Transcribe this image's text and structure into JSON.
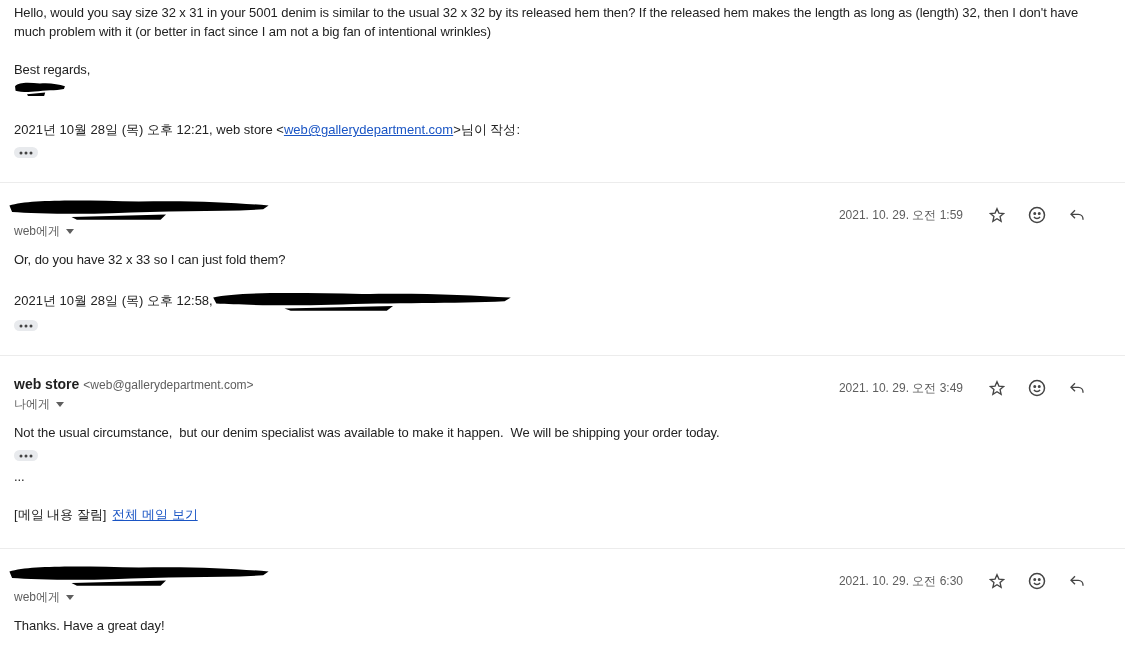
{
  "messages": [
    {
      "blocks": [
        {
          "kind": "text",
          "text": "Hello, would you say size 32 x 31 in your 5001 denim is similar to the usual 32 x 32 by its released hem then? If the released hem makes the length as long as (length) 32, then I don't have much problem with it (or better in fact since I am not a big fan of intentional wrinkles)"
        },
        {
          "kind": "text",
          "text": "Best regards,"
        },
        {
          "kind": "redaction"
        },
        {
          "kind": "quote",
          "prefix": "2021년 10월 28일 (목) 오후 12:21, web store <",
          "link": "web@gallerydepartment.com",
          "suffix": ">님이 작성:"
        },
        {
          "kind": "more"
        }
      ]
    },
    {
      "header": {
        "redacted": true,
        "recipient": "web에게",
        "date": "2021. 10. 29. 오전 1:59"
      },
      "blocks": [
        {
          "kind": "text",
          "text": "Or, do you have 32 x 33 so I can just fold them?"
        },
        {
          "kind": "quote",
          "prefix": "2021년 10월 28일 (목) 오후 12:58,",
          "redacted": true
        },
        {
          "kind": "more"
        }
      ]
    },
    {
      "header": {
        "redacted": false,
        "sender": "web store",
        "address": "<web@gallerydepartment.com>",
        "recipient": "나에게",
        "date": "2021. 10. 29. 오전 3:49"
      },
      "blocks": [
        {
          "kind": "text",
          "text": "Not the usual circumstance,  but our denim specialist was available to make it happen.  We will be shipping your order today."
        },
        {
          "kind": "more"
        },
        {
          "kind": "text",
          "text": "..."
        },
        {
          "kind": "clipped",
          "label": "[메일 내용 잘림]",
          "link": "전체 메일 보기"
        }
      ]
    },
    {
      "header": {
        "redacted": true,
        "recipient": "web에게",
        "date": "2021. 10. 29. 오전 6:30"
      },
      "blocks": [
        {
          "kind": "text",
          "text": "Thanks. Have a great day!"
        }
      ]
    }
  ]
}
